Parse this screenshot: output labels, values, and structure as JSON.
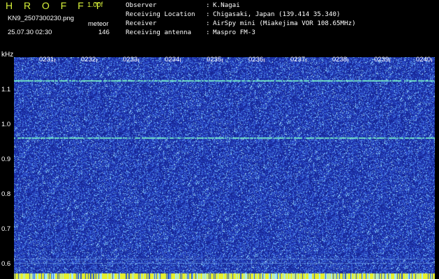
{
  "header": {
    "app_title": "H R O F F T",
    "version": "1.00f",
    "file_name": "KN9_2507300230.png",
    "mode": "meteor",
    "date_time": "25.07.30 02:30",
    "count": "146"
  },
  "info": [
    {
      "key": "Observer",
      "value": "K.Nagai"
    },
    {
      "key": "Receiving Location",
      "value": "Chigasaki, Japan (139.414 35.340)"
    },
    {
      "key": "Receiver",
      "value": "AirSpy mini (Miakejima VOR 108.65MHz)"
    },
    {
      "key": "Receiving antenna",
      "value": "Maspro FM-3"
    }
  ],
  "spectrogram": {
    "unit": "kHz",
    "y_labels": [
      "1.1",
      "1.0",
      "0.9",
      "0.8",
      "0.7",
      "0.6"
    ],
    "y_values": [
      1.1,
      1.0,
      0.9,
      0.8,
      0.7,
      0.6
    ],
    "ylim": [
      0.58,
      1.17
    ],
    "x_labels": [
      "0231",
      "0232",
      "0233",
      "0234",
      "0235",
      "0236",
      "0237",
      "0238",
      "0239",
      "0240"
    ],
    "carrier_lines_khz": [
      1.108,
      0.952,
      0.62,
      0.608
    ],
    "colors": {
      "background": "#000000",
      "noise_base": "#1a2fa8",
      "noise_mid": "#3f72e0",
      "noise_high": "#8be8ff",
      "carrier": "#6fe0c8",
      "bottom_strip": "#e6f02a"
    }
  }
}
